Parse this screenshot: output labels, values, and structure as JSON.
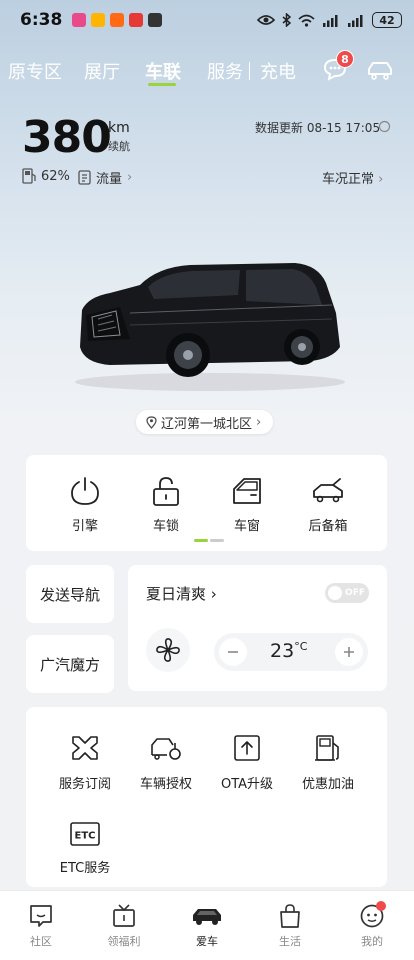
{
  "status_bar": {
    "time": "6:38",
    "battery": "42",
    "apps": [
      {
        "icon": "app-icon-1",
        "color": "#e94b8a"
      },
      {
        "icon": "app-icon-2",
        "color": "#ffb400"
      },
      {
        "icon": "app-icon-3",
        "color": "#ff6a13"
      },
      {
        "icon": "app-icon-4",
        "color": "#e53935"
      },
      {
        "icon": "app-icon-5",
        "color": "#333333"
      }
    ]
  },
  "tabs": [
    {
      "label": "原专区"
    },
    {
      "label": "展厅"
    },
    {
      "label": "车联",
      "active": true
    },
    {
      "label": "服务"
    },
    {
      "label": "充电"
    }
  ],
  "messages": {
    "badge": "8"
  },
  "vehicle": {
    "range_value": "380",
    "range_unit": "km",
    "range_label": "续航",
    "update_text": "数据更新 08-15 17:05",
    "fuel_percent": "62%",
    "traffic_label": "流量",
    "status_text": "车况正常",
    "location": "辽河第一城北区"
  },
  "controls": [
    {
      "label": "引擎",
      "icon": "power-icon"
    },
    {
      "label": "车锁",
      "icon": "lock-icon"
    },
    {
      "label": "车窗",
      "icon": "car-window-icon"
    },
    {
      "label": "后备箱",
      "icon": "trunk-icon"
    }
  ],
  "quick_actions": {
    "send_nav": "发送导航",
    "magic_cube": "广汽魔方"
  },
  "climate": {
    "mode_title": "夏日清爽",
    "toggle_text": "OFF",
    "temperature": "23",
    "temp_unit": "°C"
  },
  "services": [
    {
      "label": "服务订阅",
      "icon": "subscription-icon"
    },
    {
      "label": "车辆授权",
      "icon": "vehicle-auth-icon"
    },
    {
      "label": "OTA升级",
      "icon": "ota-upgrade-icon"
    },
    {
      "label": "优惠加油",
      "icon": "fuel-pump-icon"
    },
    {
      "label": "ETC服务",
      "icon": "etc-icon",
      "icon_text": "ETC"
    }
  ],
  "bottom_nav": [
    {
      "label": "社区",
      "icon": "community-icon"
    },
    {
      "label": "领福利",
      "icon": "gift-tv-icon"
    },
    {
      "label": "爱车",
      "icon": "car-icon",
      "active": true
    },
    {
      "label": "生活",
      "icon": "shopping-bag-icon"
    },
    {
      "label": "我的",
      "icon": "profile-icon"
    }
  ],
  "colors": {
    "accent_green": "#9ad33c",
    "badge_red": "#f04a4a"
  }
}
